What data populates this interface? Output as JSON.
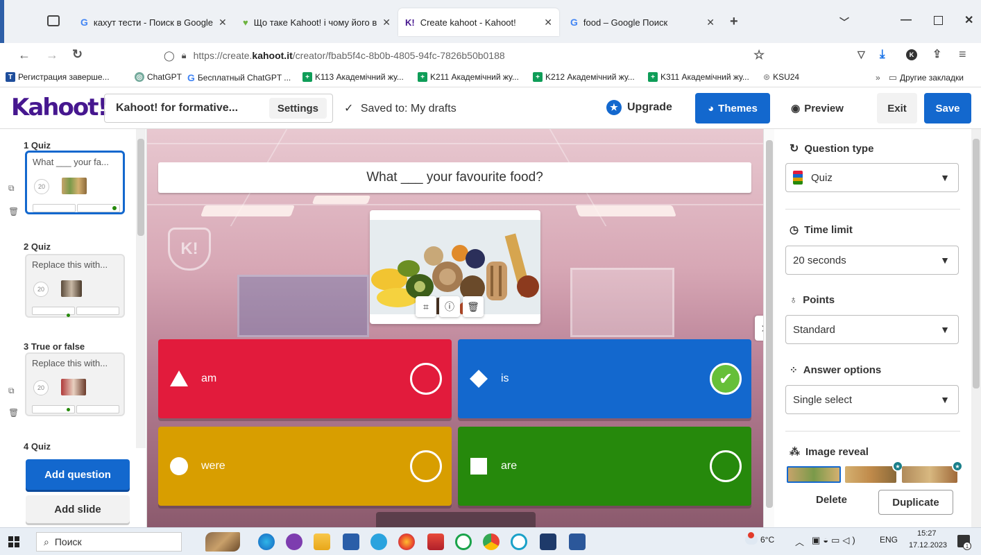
{
  "browser": {
    "tabs": [
      {
        "label": "кахут тести - Поиск в Google",
        "icon": "google-icon"
      },
      {
        "label": "Що таке Kahoot! і чому його в",
        "icon": "kahoot-blog-icon"
      },
      {
        "label": "Create kahoot - Kahoot!",
        "icon": "kahoot-icon",
        "active": true
      },
      {
        "label": "food – Google Поиск",
        "icon": "google-icon"
      }
    ],
    "url_prefix": "https://create.",
    "url_domain": "kahoot.it",
    "url_path": "/creator/fbab5f4c-8b0b-4805-94fc-7826b50b0188",
    "bookmarks": [
      "Регистрация заверше...",
      "ChatGPT",
      "Бесплатный ChatGPT ...",
      "K113 Академічний жу...",
      "K211 Академічний жу...",
      "K212 Академічний жу...",
      "K311 Академічний жу...",
      "KSU24"
    ],
    "other_bookmarks": "Другие закладки"
  },
  "header": {
    "logo": "Kahoot!",
    "title": "Kahoot! for formative...",
    "settings_label": "Settings",
    "saved_text": "Saved to: My drafts",
    "upgrade_label": "Upgrade",
    "themes_label": "Themes",
    "preview_label": "Preview",
    "exit_label": "Exit",
    "save_label": "Save"
  },
  "sidebar": {
    "slides": [
      {
        "label": "1 Quiz",
        "question": "What ___ your fa...",
        "time": "20"
      },
      {
        "label": "2 Quiz",
        "question": "Replace this with...",
        "time": "20"
      },
      {
        "label": "3 True or false",
        "question": "Replace this with...",
        "time": "20"
      },
      {
        "label": "4 Quiz"
      }
    ],
    "add_question_label": "Add question",
    "add_slide_label": "Add slide"
  },
  "editor": {
    "question": "What ___ your favourite food?",
    "answers": [
      {
        "text": "am",
        "color": "#e21b3c",
        "shape": "triangle",
        "correct": false
      },
      {
        "text": "is",
        "color": "#1368ce",
        "shape": "diamond",
        "correct": true
      },
      {
        "text": "were",
        "color": "#d89e00",
        "shape": "circle",
        "correct": false
      },
      {
        "text": "are",
        "color": "#26890c",
        "shape": "square",
        "correct": false
      }
    ]
  },
  "panel": {
    "question_type_title": "Question type",
    "question_type_value": "Quiz",
    "time_limit_title": "Time limit",
    "time_limit_value": "20 seconds",
    "points_title": "Points",
    "points_value": "Standard",
    "answer_options_title": "Answer options",
    "answer_options_value": "Single select",
    "image_reveal_title": "Image reveal",
    "delete_label": "Delete",
    "duplicate_label": "Duplicate"
  },
  "taskbar": {
    "search_label": "Поиск",
    "weather": "6°C",
    "language": "ENG",
    "time": "15:27",
    "date": "17.12.2023"
  },
  "colors": {
    "kahoot_purple": "#46178f",
    "kahoot_blue": "#1368ce",
    "red": "#e21b3c",
    "blue": "#1368ce",
    "yellow": "#d89e00",
    "green": "#26890c",
    "correct_green": "#66bf39"
  }
}
